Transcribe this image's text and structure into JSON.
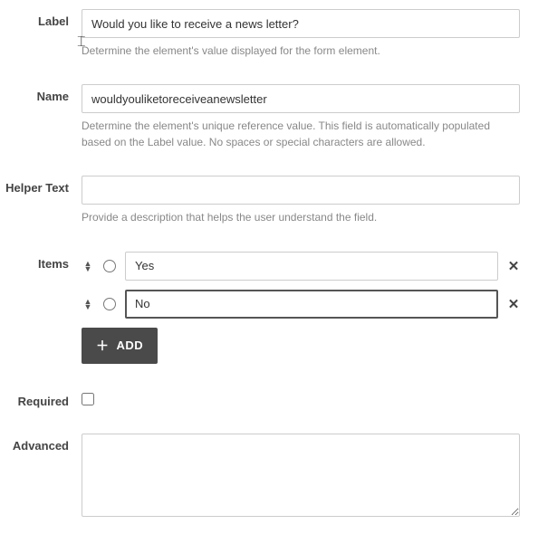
{
  "fields": {
    "label": {
      "label": "Label",
      "value": "Would you like to receive a news letter?",
      "helper": "Determine the element's value displayed for the form element."
    },
    "name": {
      "label": "Name",
      "value": "wouldyouliketoreceiveanewsletter",
      "helper": "Determine the element's unique reference value. This field is automatically populated based on the Label value. No spaces or special characters are allowed."
    },
    "helperText": {
      "label": "Helper Text",
      "value": "",
      "helper": "Provide a description that helps the user understand the field."
    },
    "items": {
      "label": "Items",
      "options": [
        {
          "value": "Yes",
          "focused": false
        },
        {
          "value": "No",
          "focused": true
        }
      ],
      "addButton": "ADD"
    },
    "required": {
      "label": "Required",
      "checked": false
    },
    "advanced": {
      "label": "Advanced",
      "value": ""
    }
  }
}
